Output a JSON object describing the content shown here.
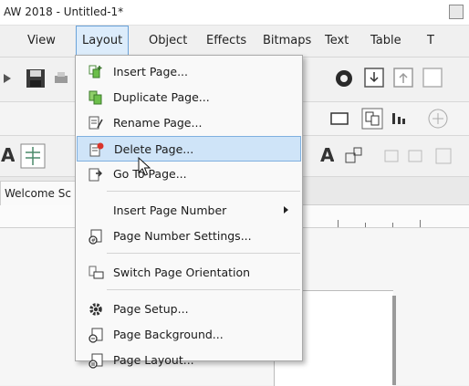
{
  "window": {
    "title": "AW 2018 - Untitled-1*"
  },
  "menubar": {
    "items": [
      {
        "label": "View"
      },
      {
        "label": "Layout"
      },
      {
        "label": "Object"
      },
      {
        "label": "Effects"
      },
      {
        "label": "Bitmaps"
      },
      {
        "label": "Text"
      },
      {
        "label": "Table"
      },
      {
        "label": "T"
      }
    ]
  },
  "document": {
    "tab_label": "Welcome Sc"
  },
  "layout_menu": {
    "items": [
      {
        "label": "Insert Page...",
        "icon": "insert-page-icon"
      },
      {
        "label": "Duplicate Page...",
        "icon": "duplicate-page-icon"
      },
      {
        "label": "Rename Page...",
        "icon": "rename-page-icon"
      },
      {
        "label": "Delete Page...",
        "icon": "delete-page-icon"
      },
      {
        "label": "Go To Page...",
        "icon": "go-to-page-icon"
      },
      {
        "label": "Insert Page Number",
        "icon": "submenu-arrow-icon"
      },
      {
        "label": "Page Number Settings...",
        "icon": "page-number-settings-icon"
      },
      {
        "label": "Switch Page Orientation",
        "icon": "switch-orientation-icon"
      },
      {
        "label": "Page Setup...",
        "icon": "gear-icon"
      },
      {
        "label": "Page Background...",
        "icon": "page-background-icon"
      },
      {
        "label": "Page Layout...",
        "icon": "page-layout-icon"
      }
    ],
    "highlighted": "Delete Page..."
  },
  "colors": {
    "highlight": "#cfe4f8",
    "highlight_border": "#7fb0e0",
    "menu_active": "#dcecfb"
  }
}
